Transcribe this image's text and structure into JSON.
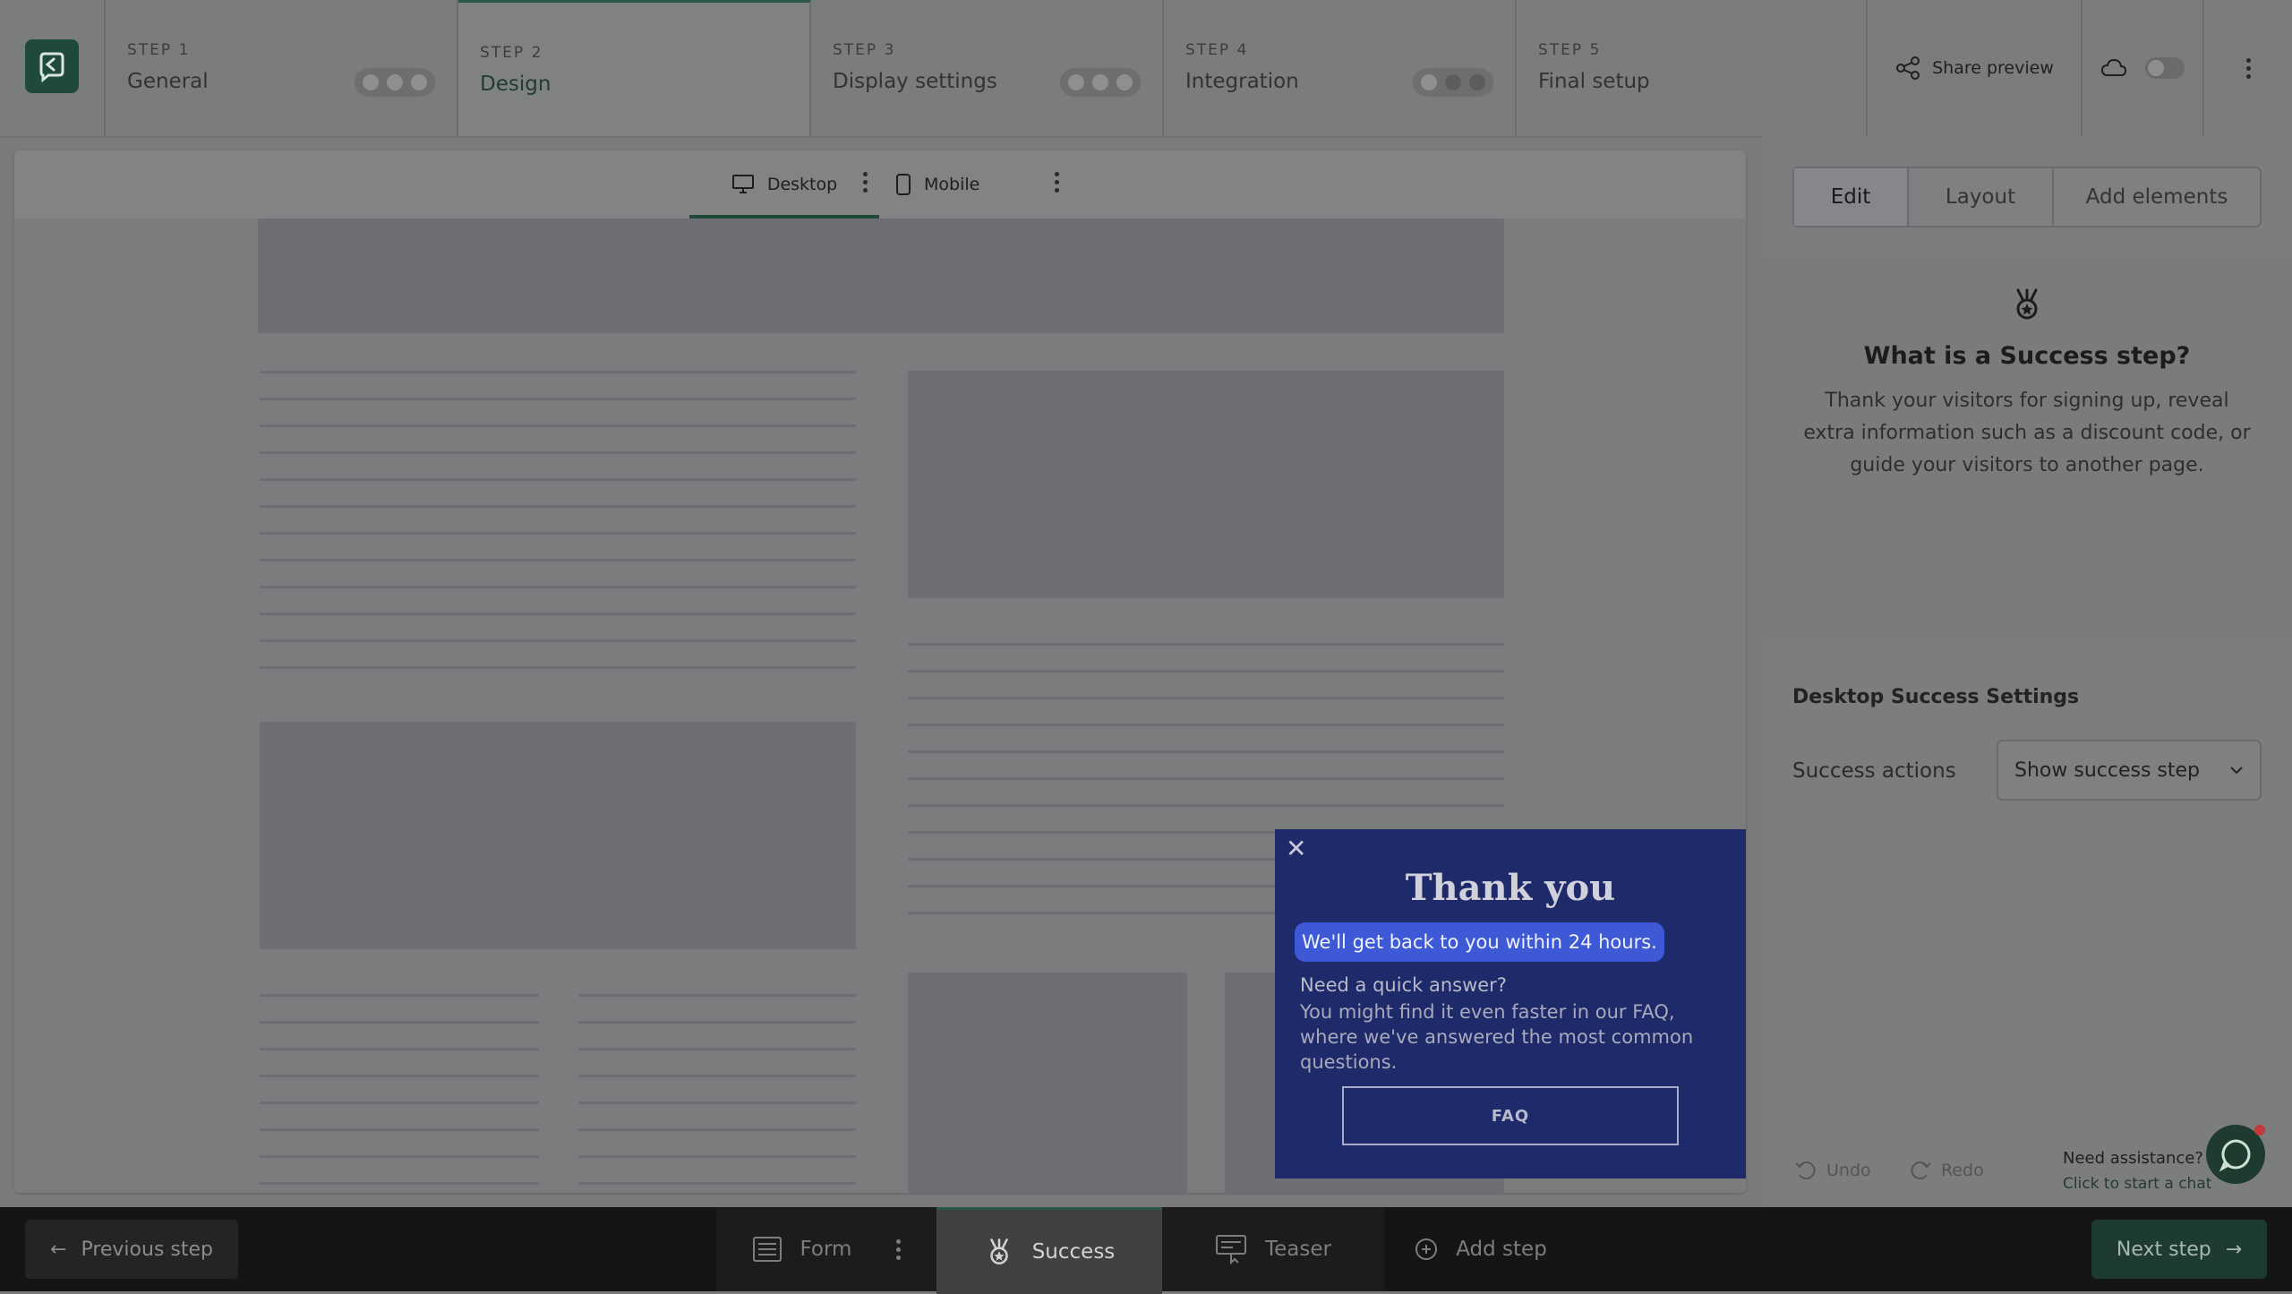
{
  "app": {
    "logo_icon": "chat-bubble-arrow-icon",
    "brand_color": "#1f4a3a"
  },
  "steps": [
    {
      "num": "STEP 1",
      "name": "General",
      "state": "full"
    },
    {
      "num": "STEP 2",
      "name": "Design",
      "state": "active"
    },
    {
      "num": "STEP 3",
      "name": "Display settings",
      "state": "full"
    },
    {
      "num": "STEP 4",
      "name": "Integration",
      "state": "partial"
    },
    {
      "num": "STEP 5",
      "name": "Final setup",
      "state": "none"
    }
  ],
  "header": {
    "share_label": "Share preview",
    "cloud_icon": "cloud-icon"
  },
  "device": {
    "desktop_label": "Desktop",
    "mobile_label": "Mobile"
  },
  "popup": {
    "close": "✕",
    "title": "Thank you",
    "pill": "We'll get back to you within 24 hours.",
    "question": "Need a quick answer?",
    "body": "You might find it even faster in our FAQ, where we've answered the most common questions.",
    "button": "FAQ",
    "bg_color": "#1e2a6a",
    "pill_color": "#3d59d6"
  },
  "panel": {
    "tabs": [
      "Edit",
      "Layout",
      "Add elements"
    ],
    "info_title": "What is a Success step?",
    "info_text": "Thank your visitors for signing up, reveal extra information such as a discount code, or guide your visitors to another page.",
    "settings_title": "Desktop Success Settings",
    "success_actions_label": "Success actions",
    "success_actions_value": "Show success step",
    "undo": "Undo",
    "redo": "Redo",
    "assist_title": "Need assistance?",
    "assist_sub": "Click to start a chat"
  },
  "bottom": {
    "prev": "Previous step",
    "form": "Form",
    "success": "Success",
    "teaser": "Teaser",
    "add_step": "Add step",
    "next": "Next step"
  }
}
